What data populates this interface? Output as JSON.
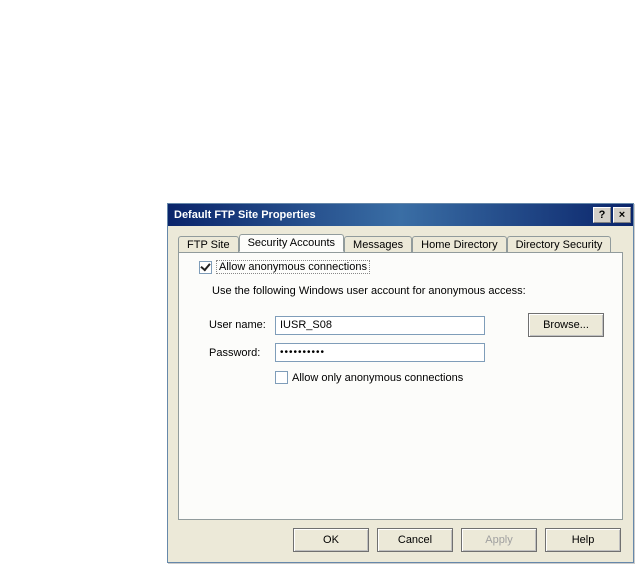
{
  "window": {
    "title": "Default FTP Site Properties",
    "help_symbol": "?",
    "close_symbol": "×"
  },
  "tabs": {
    "ftp_site": "FTP Site",
    "security_accounts": "Security Accounts",
    "messages": "Messages",
    "home_directory": "Home Directory",
    "directory_security": "Directory Security"
  },
  "panel": {
    "allow_anonymous_label": "Allow anonymous connections",
    "allow_anonymous_checked": true,
    "description": "Use the following Windows user account for anonymous access:",
    "username_label": "User name:",
    "username_value": "IUSR_S08",
    "browse_label": "Browse...",
    "password_label": "Password:",
    "password_masked": "••••••••••",
    "allow_only_label": "Allow only anonymous connections",
    "allow_only_checked": false
  },
  "buttons": {
    "ok": "OK",
    "cancel": "Cancel",
    "apply": "Apply",
    "help": "Help"
  }
}
